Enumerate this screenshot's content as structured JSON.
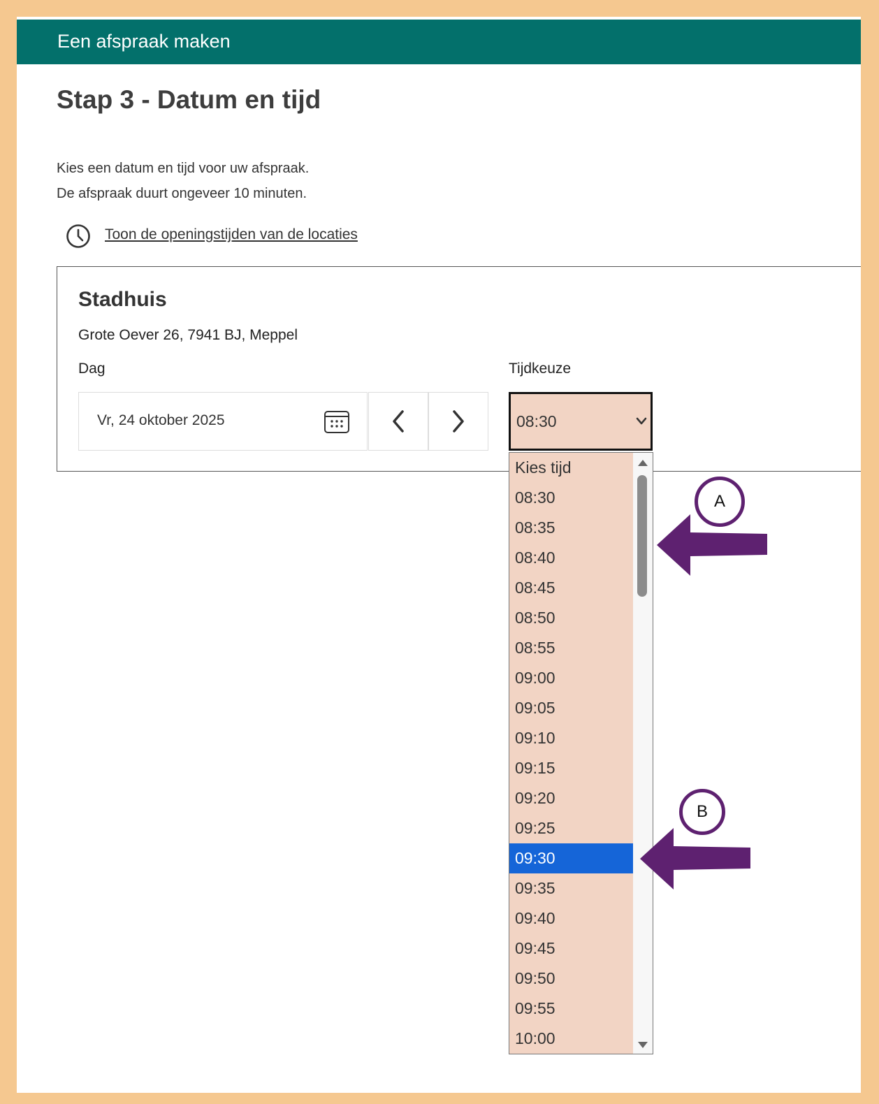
{
  "header": {
    "title": "Een afspraak maken"
  },
  "step_title": "Stap 3 - Datum en tijd",
  "intro": {
    "line1": "Kies een datum en tijd voor uw afspraak.",
    "line2": "De afspraak duurt ongeveer 10 minuten."
  },
  "opening_hours_link": "Toon de openingstijden van de locaties",
  "location": {
    "name": "Stadhuis",
    "address": "Grote Oever 26, 7941 BJ, Meppel",
    "day_label": "Dag",
    "date_value": "Vr, 24 oktober 2025",
    "time_label": "Tijdkeuze",
    "time_value": "08:30"
  },
  "time_options": [
    "Kies tijd",
    "08:30",
    "08:35",
    "08:40",
    "08:45",
    "08:50",
    "08:55",
    "09:00",
    "09:05",
    "09:10",
    "09:15",
    "09:20",
    "09:25",
    "09:30",
    "09:35",
    "09:40",
    "09:45",
    "09:50",
    "09:55",
    "10:00"
  ],
  "highlighted_option": "09:30",
  "annotations": {
    "marker_a": "A",
    "marker_b": "B"
  },
  "colors": {
    "header_bg": "#03706b",
    "frame_border": "#f5c890",
    "select_bg": "#f2d4c4",
    "highlight": "#1565d8",
    "annotation": "#5e2170"
  },
  "icons": [
    "clock-icon",
    "calendar-icon",
    "chevron-left-icon",
    "chevron-right-icon",
    "chevron-down-icon"
  ]
}
